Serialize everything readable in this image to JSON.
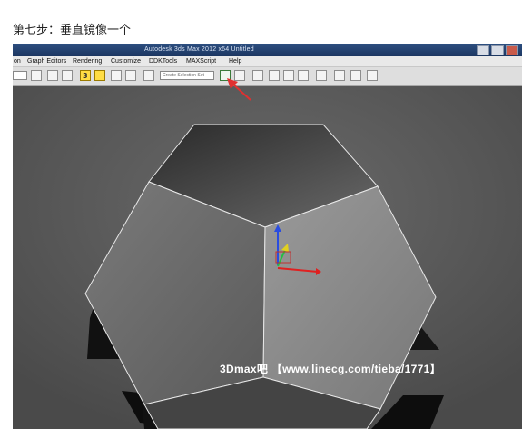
{
  "caption": "第七步：垂直镜像一个",
  "window": {
    "title": "Autodesk 3ds Max  2012 x64     Untitled",
    "menu": [
      "on",
      "Graph Editors",
      "Rendering",
      "Customize",
      "DDKTools",
      "MAXScript",
      "Help"
    ]
  },
  "toolbar": {
    "selection_set_placeholder": "Create Selection Set",
    "snap_percent": "3",
    "highlighted_tool": "mirror"
  },
  "icons": [
    "select-icon",
    "move-icon",
    "snap-3d-icon",
    "angle-snap-icon",
    "percent-snap-icon",
    "spinner-snap-icon",
    "edit-named-selection-icon",
    "mirror-icon",
    "align-icon",
    "layer-manager-icon",
    "curve-editor-icon",
    "schematic-view-icon",
    "material-editor-icon",
    "render-setup-icon",
    "render-frame-icon",
    "render-icon"
  ],
  "watermark": "3Dmax吧 【www.linecg.com/tieba/1771】",
  "colors": {
    "annotation_arrow": "#e03030",
    "viewport_bg": "#595959",
    "title_bar": "#1c3661"
  }
}
